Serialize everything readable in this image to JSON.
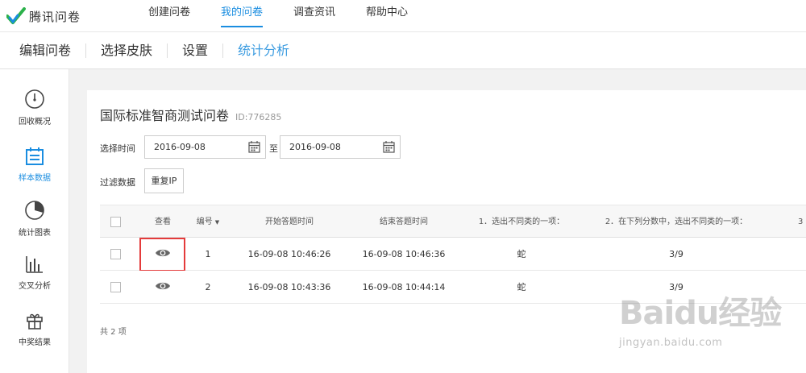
{
  "app": {
    "logo_text": "腾讯问卷"
  },
  "topnav": [
    {
      "label": "创建问卷"
    },
    {
      "label": "我的问卷",
      "active": true
    },
    {
      "label": "调查资讯"
    },
    {
      "label": "帮助中心"
    }
  ],
  "subnav": [
    {
      "label": "编辑问卷"
    },
    {
      "label": "选择皮肤"
    },
    {
      "label": "设置"
    },
    {
      "label": "统计分析",
      "active": true
    }
  ],
  "sidebar": [
    {
      "label": "回收概况",
      "icon": "gauge-icon"
    },
    {
      "label": "样本数据",
      "icon": "calendar-icon",
      "active": true
    },
    {
      "label": "统计图表",
      "icon": "pie-chart-icon"
    },
    {
      "label": "交叉分析",
      "icon": "bar-chart-icon"
    },
    {
      "label": "中奖结果",
      "icon": "gift-icon"
    }
  ],
  "survey": {
    "title": "国际标准智商测试问卷",
    "id_text": "ID:776285"
  },
  "filters": {
    "time_label": "选择时间",
    "start_date": "2016-09-08",
    "to_label": "至",
    "end_date": "2016-09-08",
    "filter_label": "过滤数据",
    "dup_ip_button": "重复IP"
  },
  "table": {
    "headers": {
      "view": "查看",
      "number": "编号",
      "start": "开始答题时间",
      "end": "结束答题时间",
      "q1": "1．选出不同类的一项：",
      "q2": "2．在下列分数中，选出不同类的一项：",
      "q3": "3"
    },
    "rows": [
      {
        "number": "1",
        "start": "16-09-08 10:46:26",
        "end": "16-09-08 10:46:36",
        "q1": "蛇",
        "q2": "3/9"
      },
      {
        "number": "2",
        "start": "16-09-08 10:43:36",
        "end": "16-09-08 10:44:14",
        "q1": "蛇",
        "q2": "3/9"
      }
    ]
  },
  "footer": {
    "total": "共 2 项"
  },
  "watermark": {
    "brand": "Baidu经验",
    "url": "jingyan.baidu.com"
  },
  "colors": {
    "accent": "#1a8de0",
    "highlight": "#e43b3b"
  }
}
